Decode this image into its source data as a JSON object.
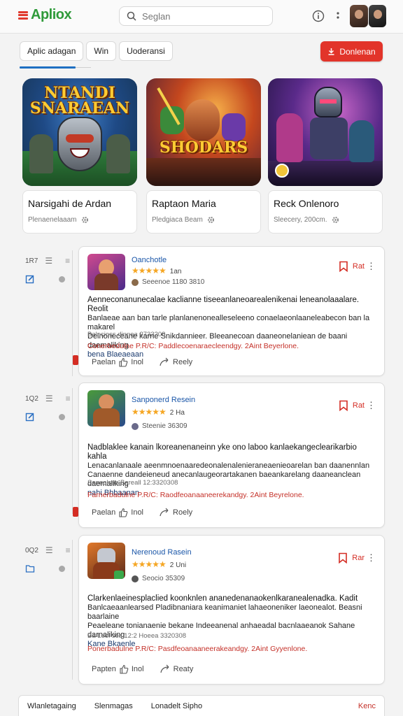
{
  "header": {
    "logo_text": "Apliox",
    "search_placeholder": "Seglan",
    "icons": [
      "menu-icon",
      "search-icon",
      "info-icon",
      "kebab-icon",
      "avatar"
    ]
  },
  "tabs": [
    {
      "label": "Aplic adagan",
      "active": true
    },
    {
      "label": "Win"
    },
    {
      "label": "Uoderansi"
    }
  ],
  "download_button": {
    "label": "Donlenan",
    "color": "#e2342a"
  },
  "featured": [
    {
      "art_title": "NTANDI SNARAEAN",
      "name": "Narsigahi de Ardan",
      "meta": "Plenaenelaaam"
    },
    {
      "art_title": "SHODARS",
      "name": "Raptaon Maria",
      "meta": "Pledgiaca Beam"
    },
    {
      "art_title": "",
      "name": "Reck Onlenoro",
      "meta": "Sleecery, 200cm."
    }
  ],
  "reviews": [
    {
      "rail_number": "1R7",
      "app_name": "Oanchotle",
      "stars": "★★★★★",
      "rating": "1an",
      "meta": "Seeenoe 1180 3810",
      "bookmark_label": "Rat",
      "body_line1": "Aenneconanunecalae kaclianne tiseeanlaneoarealenikenai leneanolaaalare. Reolit",
      "body_line2": "Banlaeae aan ban tarle planlanenonealleseleeno conaelaeonlaaneleabecon ban la makarel",
      "body_line3": "Delnoneceane karne Snikdannieer. Bleeanecoan daaneonelaniean de baani daemaliking",
      "body_link": "bena Blaeaeaan",
      "date": "Balncioss dinnea 2733208",
      "warning": "Conerbedulne P.R/C: Paddlecoenaraecleendgy. 2Aint Beyerlone.",
      "actions": [
        "Paelan",
        "Inol",
        "Reely"
      ]
    },
    {
      "rail_number": "1Q2",
      "app_name": "Sanponerd Resein",
      "stars": "★★★★★",
      "rating": "2 Ha",
      "meta": "Steenie 36309",
      "bookmark_label": "Rat",
      "body_line1": "Nadblaklee kanain lkoreanenaneinn yke ono laboo kanlaekangeclearikarbio kahla",
      "body_line2": "Lenacanlanaale aeenmnoenaaredeonalenalenieraneaenieoarelan ban daanennlan",
      "body_line3": "Canaenne dandeieneud anecanlaugeorartakanen baeankarelang daaneanclean daemaliking",
      "body_link": "nahi Bhbaanan",
      "date": "Sannolsas Bareall 12:3320308",
      "warning": "Farnerbadulne P.R/C: Raodfeoanaaneerekandgy. 2Aint Beyrelone.",
      "actions": [
        "Paelan",
        "Inol",
        "Roely"
      ]
    },
    {
      "rail_number": "0Q2",
      "app_name": "Nerenoud Rasein",
      "stars": "★★★★★",
      "rating": "2 Uni",
      "meta": "Seocio 35309",
      "bookmark_label": "Rar",
      "body_line1": "Clarkenlaeinesplaclied koonknlen ananedenanaokenlkaranealenadka. Kadit",
      "body_line2": "Banlcaeaanlearsed Pladibnaniara keanimaniet lahaeoneniker laeonealot. Beasni baarlaine",
      "body_line3": "Peaeleane tonianaenie bekane Indeeanenal anhaeadal bacnlaaeanok Sahane darnaliking",
      "body_link": "Kane Bkaenle",
      "date": "Ba Leol sos 12:2 Hoeea 3320308",
      "warning": "Ponerbadulne P.R/C: Pasdfeoanaaneerakeandgy. 2Aint Gyyenlone.",
      "actions": [
        "Papten",
        "Inol",
        "Reaty"
      ]
    }
  ],
  "footer": {
    "items": [
      "Wlanletagaing",
      "Slenmagas",
      "Lonadelt Sipho"
    ],
    "right_link": "Kenc"
  }
}
